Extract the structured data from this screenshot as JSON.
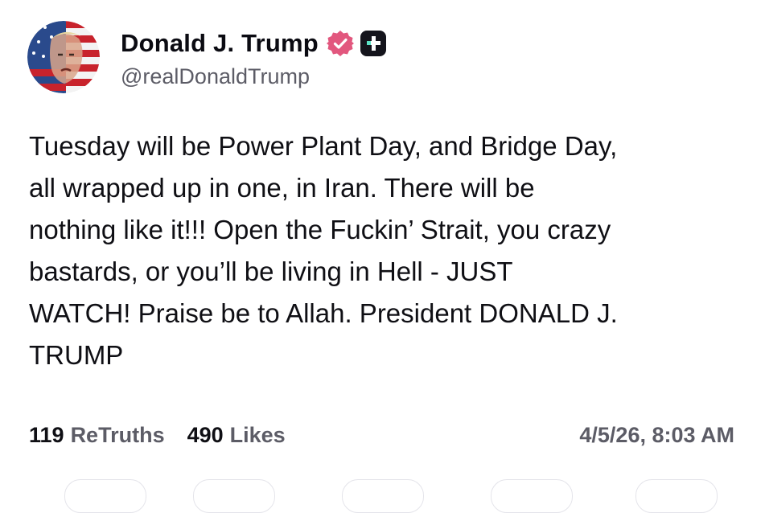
{
  "author": {
    "display_name": "Donald J. Trump",
    "handle": "@realDonaldTrump",
    "avatar_icon": "avatar-flag-portrait",
    "verified_icon": "verified-badge-icon",
    "verified_color": "#e2577e",
    "plus_icon": "truth-plus-icon"
  },
  "post": {
    "text": "Tuesday will be Power Plant Day, and Bridge Day,\nall wrapped up in one, in Iran. There will be\nnothing like it!!! Open the Fuckin’ Strait, you crazy\nbastards, or you’ll be living in Hell - JUST\nWATCH! Praise be to Allah. President DONALD J.\nTRUMP"
  },
  "stats": {
    "retruths_count": "119",
    "retruths_label": "ReTruths",
    "likes_count": "490",
    "likes_label": "Likes",
    "timestamp": "4/5/26, 8:03 AM"
  }
}
